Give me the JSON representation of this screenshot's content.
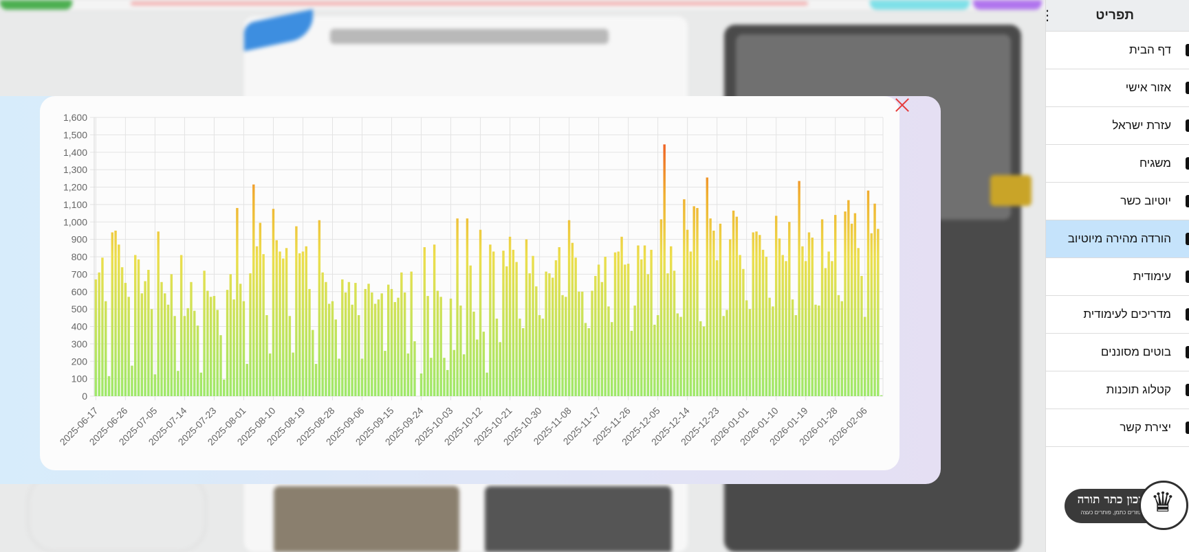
{
  "sidebar": {
    "menu_title": "תפריט",
    "items": [
      {
        "label": "דף הבית"
      },
      {
        "label": "אזור אישי"
      },
      {
        "label": "עזרת ישראל"
      },
      {
        "label": "משגיח"
      },
      {
        "label": "יוטיוב כשר"
      },
      {
        "label": "הורדה מהירה מיוטיוב",
        "active": true
      },
      {
        "label": "עימודית"
      },
      {
        "label": "מדריכים לעימודית"
      },
      {
        "label": "בוטים מסוננים"
      },
      {
        "label": "קטלוג תוכנות"
      },
      {
        "label": "יצירת קשר"
      }
    ],
    "logo": {
      "title": "מכון כתר תורה",
      "subtitle": "עוזרים כתמן, פותרים כעצה"
    }
  },
  "colors": {
    "accent_active": "#c5e3fb",
    "close": "#e53b3b",
    "bar_low": "#9ee86a",
    "bar_mid": "#ecde4c",
    "bar_high": "#ee5a2a"
  },
  "icons": {
    "close": "close-icon",
    "menu": "hamburger-icon"
  },
  "chart_data": {
    "type": "bar",
    "title": "",
    "xlabel": "",
    "ylabel": "",
    "ylim": [
      0,
      1600
    ],
    "yticks": [
      0,
      100,
      200,
      300,
      400,
      500,
      600,
      700,
      800,
      900,
      1000,
      1100,
      1200,
      1300,
      1400,
      1500,
      1600
    ],
    "xtick_labels": [
      "2025-06-17",
      "2025-06-26",
      "2025-07-05",
      "2025-07-14",
      "2025-07-23",
      "2025-08-01",
      "2025-08-10",
      "2025-08-19",
      "2025-08-28",
      "2025-09-06",
      "2025-09-15",
      "2025-09-24",
      "2025-10-03",
      "2025-10-12",
      "2025-10-21",
      "2025-10-30",
      "2025-11-08",
      "2025-11-17",
      "2025-11-26",
      "2025-12-05",
      "2025-12-14",
      "2025-12-23",
      "2026-01-01",
      "2026-01-10",
      "2026-01-19",
      "2026-01-28",
      "2026-02-06"
    ],
    "grid": true,
    "legend": false,
    "series": [
      {
        "values": [
          670,
          710,
          795,
          545,
          115,
          940,
          950,
          870,
          740,
          650,
          570,
          175,
          810,
          785,
          590,
          660,
          725,
          500,
          125,
          945,
          655,
          590,
          525,
          700,
          460,
          145,
          810,
          460,
          505,
          655,
          490,
          405,
          135,
          720,
          605,
          570,
          575,
          495,
          350,
          95,
          610,
          700,
          555,
          1080,
          645,
          545,
          185,
          705,
          1215,
          860,
          995,
          815,
          465,
          245,
          1075,
          895,
          830,
          790,
          850,
          460,
          250,
          975,
          820,
          830,
          860,
          615,
          380,
          185,
          1010,
          710,
          655,
          530,
          545,
          440,
          215,
          670,
          595,
          655,
          525,
          650,
          465,
          215,
          615,
          645,
          595,
          530,
          555,
          590,
          260,
          640,
          615,
          540,
          565,
          710,
          595,
          245,
          715,
          315,
          0,
          130,
          855,
          575,
          220,
          870,
          605,
          570,
          220,
          150,
          560,
          265,
          1020,
          520,
          240,
          1020,
          750,
          485,
          325,
          955,
          370,
          135,
          870,
          830,
          445,
          310,
          835,
          745,
          915,
          840,
          770,
          445,
          390,
          900,
          705,
          805,
          630,
          465,
          445,
          715,
          705,
          680,
          780,
          855,
          580,
          570,
          1010,
          880,
          795,
          600,
          600,
          420,
          390,
          605,
          690,
          755,
          655,
          800,
          515,
          425,
          825,
          830,
          915,
          755,
          760,
          375,
          520,
          865,
          785,
          865,
          700,
          840,
          410,
          465,
          1015,
          1445,
          705,
          860,
          720,
          475,
          455,
          1130,
          955,
          830,
          1090,
          1080,
          430,
          400,
          1255,
          1020,
          950,
          780,
          990,
          460,
          495,
          900,
          1065,
          1030,
          810,
          730,
          550,
          500,
          940,
          945,
          925,
          840,
          800,
          565,
          515,
          1035,
          905,
          810,
          775,
          1000,
          555,
          465,
          1235,
          860,
          775,
          940,
          910,
          525,
          520,
          1015,
          735,
          830,
          775,
          1040,
          580,
          545,
          1060,
          1125,
          990,
          1050,
          850,
          690,
          455,
          1180,
          935,
          1105,
          960,
          5
        ]
      }
    ]
  }
}
